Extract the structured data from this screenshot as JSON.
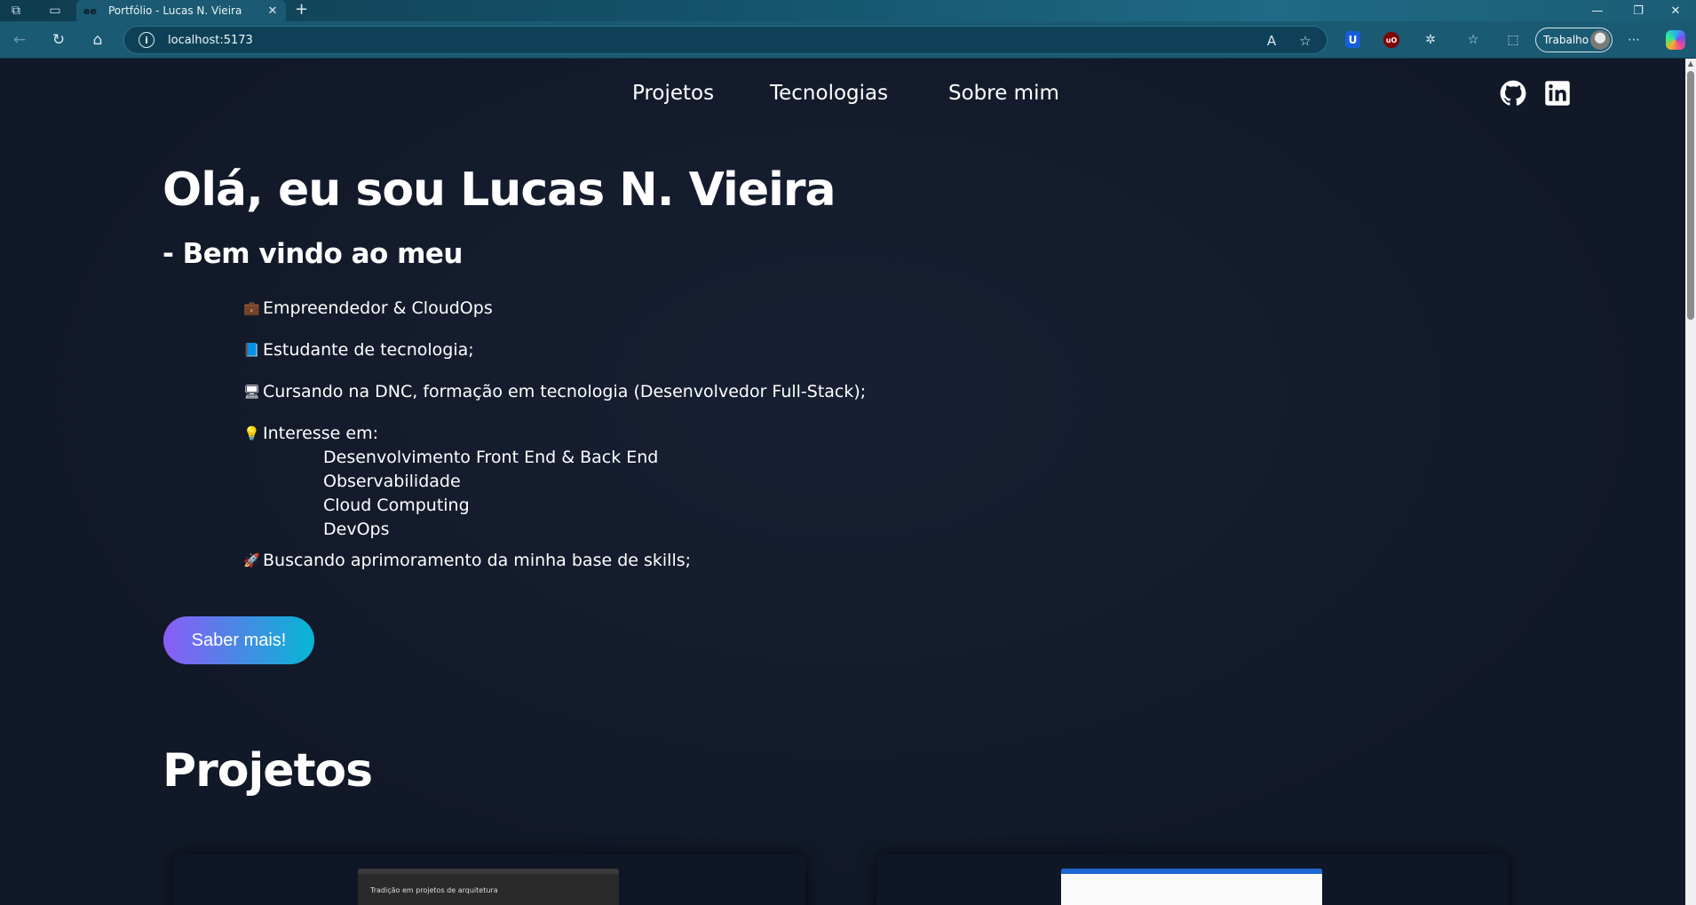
{
  "browser": {
    "tab_title": "Portfólio - Lucas N. Vieira",
    "tab_favicon": "ee",
    "url": "localhost:5173",
    "profile_label": "Trabalho",
    "extension_ublock": "uO"
  },
  "nav": {
    "links": [
      "Projetos",
      "Tecnologias",
      "Sobre mim"
    ]
  },
  "hero": {
    "title": "Olá, eu sou Lucas N. Vieira",
    "subtitle": "- Bem vindo ao meu",
    "facts": [
      {
        "icon": "briefcase-icon",
        "text": "Empreendedor & CloudOps"
      },
      {
        "icon": "book-icon",
        "text": "Estudante de tecnologia;"
      },
      {
        "icon": "desktop-icon",
        "text": "Cursando na DNC, formação em tecnologia (Desenvolvedor Full-Stack);"
      },
      {
        "icon": "lightbulb-icon",
        "text": "Interesse em:"
      },
      {
        "icon": "rocket-icon",
        "text": "Buscando aprimoramento da minha base de skills;"
      }
    ],
    "interests": [
      "Desenvolvimento Front End & Back End",
      "Observabilidade",
      "Cloud Computing",
      "DevOps"
    ],
    "cta_label": "Saber mais!"
  },
  "projects": {
    "heading": "Projetos",
    "card1_thumb_title": "Tradição em projetos de arquitetura"
  },
  "colors": {
    "background": "#111827",
    "cta_gradient_start": "#8b5cf6",
    "cta_gradient_end": "#06b6d4",
    "browser_toolbar": "#1a5a72"
  }
}
